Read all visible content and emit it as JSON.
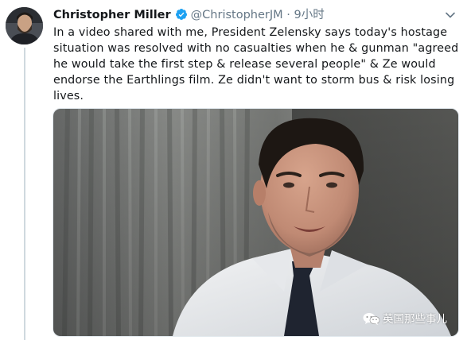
{
  "tweet": {
    "author_name": "Christopher Miller",
    "handle": "@ChristopherJM",
    "separator": "·",
    "time": "9小时",
    "text": "In a video shared with me, President Zelensky says today's hostage situation was resolved with no casualties when he & gunman \"agreed he would take the first step & release several people\" & Ze would endorse the Earthlings film. Ze didn't want to storm bus & risk losing lives."
  },
  "watermark": {
    "text": "英国那些事儿",
    "icon": "wechat-icon"
  },
  "icons": {
    "verified": "verified-badge-icon",
    "menu": "chevron-down-icon"
  },
  "colors": {
    "verified_blue": "#1da1f2",
    "secondary_text": "#657786",
    "primary_text": "#14171a"
  }
}
